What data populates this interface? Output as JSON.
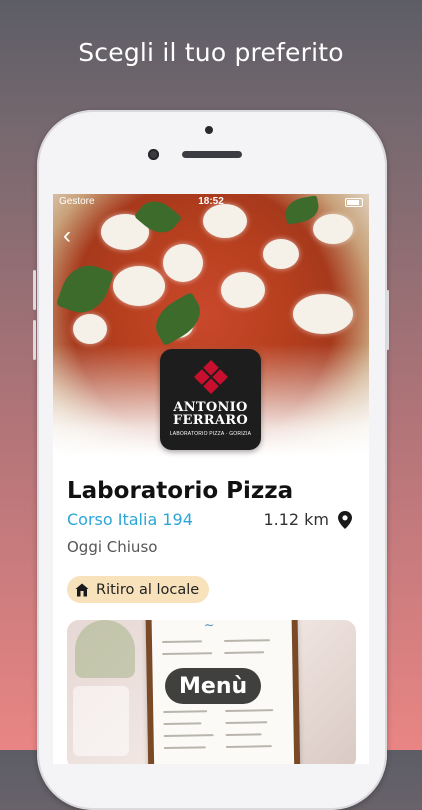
{
  "headline": "Scegli il tuo preferito",
  "status_bar": {
    "carrier": "Gestore",
    "time": "18:52"
  },
  "restaurant": {
    "logo_name_line1": "ANTONIO",
    "logo_name_line2": "FERRARO",
    "logo_subtitle": "LABORATORIO PIZZA · GORIZIA",
    "title": "Laboratorio Pizza",
    "address": "Corso Italia 194",
    "distance": "1.12 km",
    "hours": "Oggi Chiuso",
    "pickup_label": "Ritiro al locale",
    "menu_label": "Menù"
  },
  "colors": {
    "accent_link": "#2ba6d6",
    "badge_bg": "#f7e2bb",
    "logo_red": "#c8102e"
  }
}
